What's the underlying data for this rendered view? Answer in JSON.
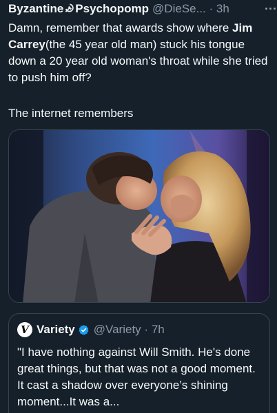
{
  "tweet": {
    "author_name_part1": "Byzantine",
    "author_name_part2": "Psychopomp",
    "handle": "@DieSe...",
    "separator": "·",
    "time": "3h",
    "more_icon": "more-horizontal-icon",
    "text_before_bold": "Damn, remember that awards show where ",
    "text_bold": "Jim Carrey",
    "text_after_bold": "(the 45 year old man) stuck his tongue down a 20 year old woman's throat while she tried to push him off?",
    "trailer": "The internet remembers"
  },
  "quote": {
    "logo_letter": "V",
    "name": "Variety",
    "verified_icon": "verified-badge-icon",
    "handle": "@Variety",
    "separator": "·",
    "time": "7h",
    "text": "\"I have nothing against Will Smith. He's done great things, but that was not a good moment. It cast a shadow over everyone’s shining moment...It was a..."
  },
  "colors": {
    "background": "#15202b",
    "text": "#f7f9f9",
    "secondary": "#8b98a5",
    "border": "#38444d",
    "verified": "#1d9bf0"
  }
}
